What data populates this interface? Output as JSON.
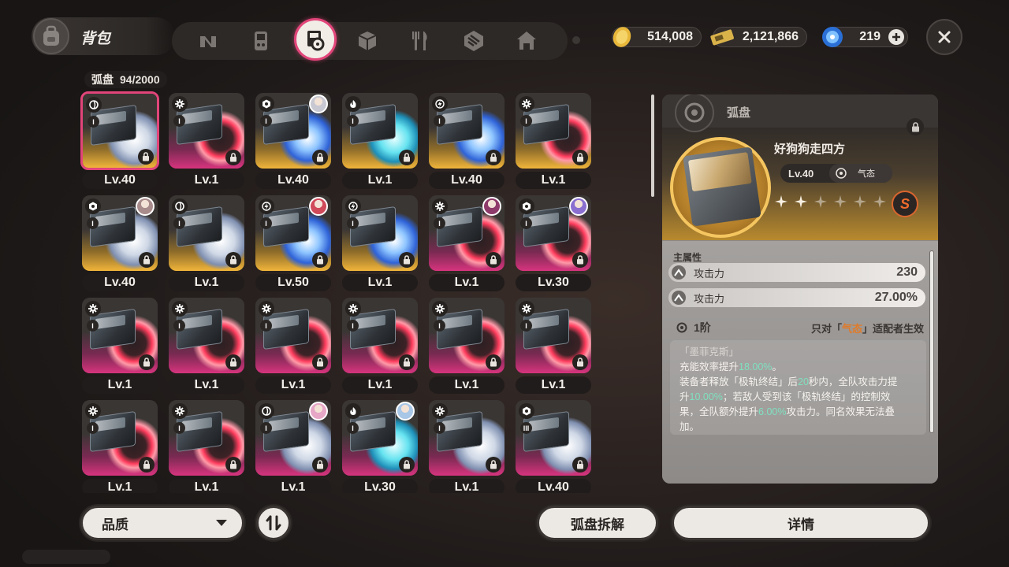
{
  "header": {
    "title": "背包",
    "categories": [
      {
        "icon": "agent-icon"
      },
      {
        "icon": "gameboy-icon"
      },
      {
        "icon": "disc-icon",
        "active": true
      },
      {
        "icon": "cube-icon"
      },
      {
        "icon": "food-icon"
      },
      {
        "icon": "pattern-icon"
      },
      {
        "icon": "home-icon"
      }
    ],
    "currencies": {
      "coin": "514,008",
      "ticket": "2,121,866",
      "energy": "219"
    }
  },
  "inventory": {
    "label": "弧盘",
    "count": "94/2000",
    "items": [
      {
        "level": "Lv.40",
        "attr": "ether",
        "tier": "I",
        "theme": "gold",
        "swirl": "white",
        "selected": true
      },
      {
        "level": "Lv.1",
        "attr": "gear",
        "tier": "I",
        "theme": "pink",
        "swirl": "red"
      },
      {
        "level": "Lv.40",
        "attr": "hex",
        "tier": "I",
        "theme": "gold",
        "swirl": "blue",
        "avatar": "#c8c8d2"
      },
      {
        "level": "Lv.1",
        "attr": "fire",
        "tier": "I",
        "theme": "gold",
        "swirl": "cyan"
      },
      {
        "level": "Lv.40",
        "attr": "bolt",
        "tier": "I",
        "theme": "gold",
        "swirl": "blue"
      },
      {
        "level": "Lv.1",
        "attr": "gear",
        "tier": "I",
        "theme": "gold",
        "swirl": "red"
      },
      {
        "level": "Lv.40",
        "attr": "hex",
        "tier": "I",
        "theme": "gold",
        "swirl": "white",
        "avatar": "#a88b8b"
      },
      {
        "level": "Lv.1",
        "attr": "ether",
        "tier": "I",
        "theme": "gold",
        "swirl": "white"
      },
      {
        "level": "Lv.50",
        "attr": "bolt",
        "tier": "I",
        "theme": "gold",
        "swirl": "blue",
        "avatar": "#d04a5a"
      },
      {
        "level": "Lv.1",
        "attr": "bolt",
        "tier": "I",
        "theme": "gold",
        "swirl": "blue"
      },
      {
        "level": "Lv.1",
        "attr": "gear",
        "tier": "I",
        "theme": "pink",
        "swirl": "red",
        "avatar": "#8e3a6a"
      },
      {
        "level": "Lv.30",
        "attr": "hex",
        "tier": "I",
        "theme": "pink",
        "swirl": "red",
        "avatar": "#8a6fd0"
      },
      {
        "level": "Lv.1",
        "attr": "gear",
        "tier": "I",
        "theme": "pink",
        "swirl": "red"
      },
      {
        "level": "Lv.1",
        "attr": "gear",
        "tier": "I",
        "theme": "pink",
        "swirl": "red"
      },
      {
        "level": "Lv.1",
        "attr": "gear",
        "tier": "I",
        "theme": "pink",
        "swirl": "red"
      },
      {
        "level": "Lv.1",
        "attr": "gear",
        "tier": "I",
        "theme": "pink",
        "swirl": "red"
      },
      {
        "level": "Lv.1",
        "attr": "gear",
        "tier": "I",
        "theme": "pink",
        "swirl": "red"
      },
      {
        "level": "Lv.1",
        "attr": "gear",
        "tier": "I",
        "theme": "pink",
        "swirl": "red"
      },
      {
        "level": "Lv.1",
        "attr": "gear",
        "tier": "I",
        "theme": "pink",
        "swirl": "red"
      },
      {
        "level": "Lv.1",
        "attr": "gear",
        "tier": "I",
        "theme": "pink",
        "swirl": "red"
      },
      {
        "level": "Lv.1",
        "attr": "ether",
        "tier": "I",
        "theme": "pink",
        "swirl": "white",
        "avatar": "#e6a6c6"
      },
      {
        "level": "Lv.30",
        "attr": "fire",
        "tier": "I",
        "theme": "pink",
        "swirl": "cyan",
        "avatar": "#a8c6e6"
      },
      {
        "level": "Lv.1",
        "attr": "gear",
        "tier": "I",
        "theme": "pink",
        "swirl": "white"
      },
      {
        "level": "Lv.40",
        "attr": "hex",
        "tier": "III",
        "theme": "pink",
        "swirl": "white"
      }
    ]
  },
  "bottom": {
    "filter_label": "品质",
    "dismantle_label": "弧盘拆解",
    "detail_label": "详情"
  },
  "detail": {
    "type": "弧盘",
    "name": "好狗狗走四方",
    "level": "Lv.40",
    "attribute": "气态",
    "stars_filled": 2,
    "stars_total": 6,
    "rank": "S",
    "main_attr_label": "主属性",
    "stats": [
      {
        "name": "攻击力",
        "value": "230"
      },
      {
        "name": "攻击力",
        "value": "27.00%"
      }
    ],
    "bonus_tier": "1阶",
    "bonus_cond_pre": "只对「",
    "bonus_cond_hl": "气态",
    "bonus_cond_post": "」适配者生效",
    "bonus_sub": "「墨菲克斯」",
    "bonus_l1_a": "充能效率提升",
    "bonus_l1_v": "18.00%",
    "bonus_l1_b": "。",
    "bonus_l2_a": "装备者释放「极轨终结」后",
    "bonus_l2_v": "20",
    "bonus_l2_b": "秒内，全队攻击力提",
    "bonus_l3_a": "升",
    "bonus_l3_v": "10.00%",
    "bonus_l3_b": "；若敌人受到该「极轨终结」的控制效",
    "bonus_l4_a": "果，全队额外提升",
    "bonus_l4_v": "6.00%",
    "bonus_l4_b": "攻击力。同名效果无法叠",
    "bonus_l5": "加。"
  },
  "colors": {
    "accent": "#e2457a",
    "gold": "#f0b53a",
    "pink": "#d7347e",
    "highlight_green": "#7fe0c0",
    "highlight_orange": "#e07b2a"
  }
}
